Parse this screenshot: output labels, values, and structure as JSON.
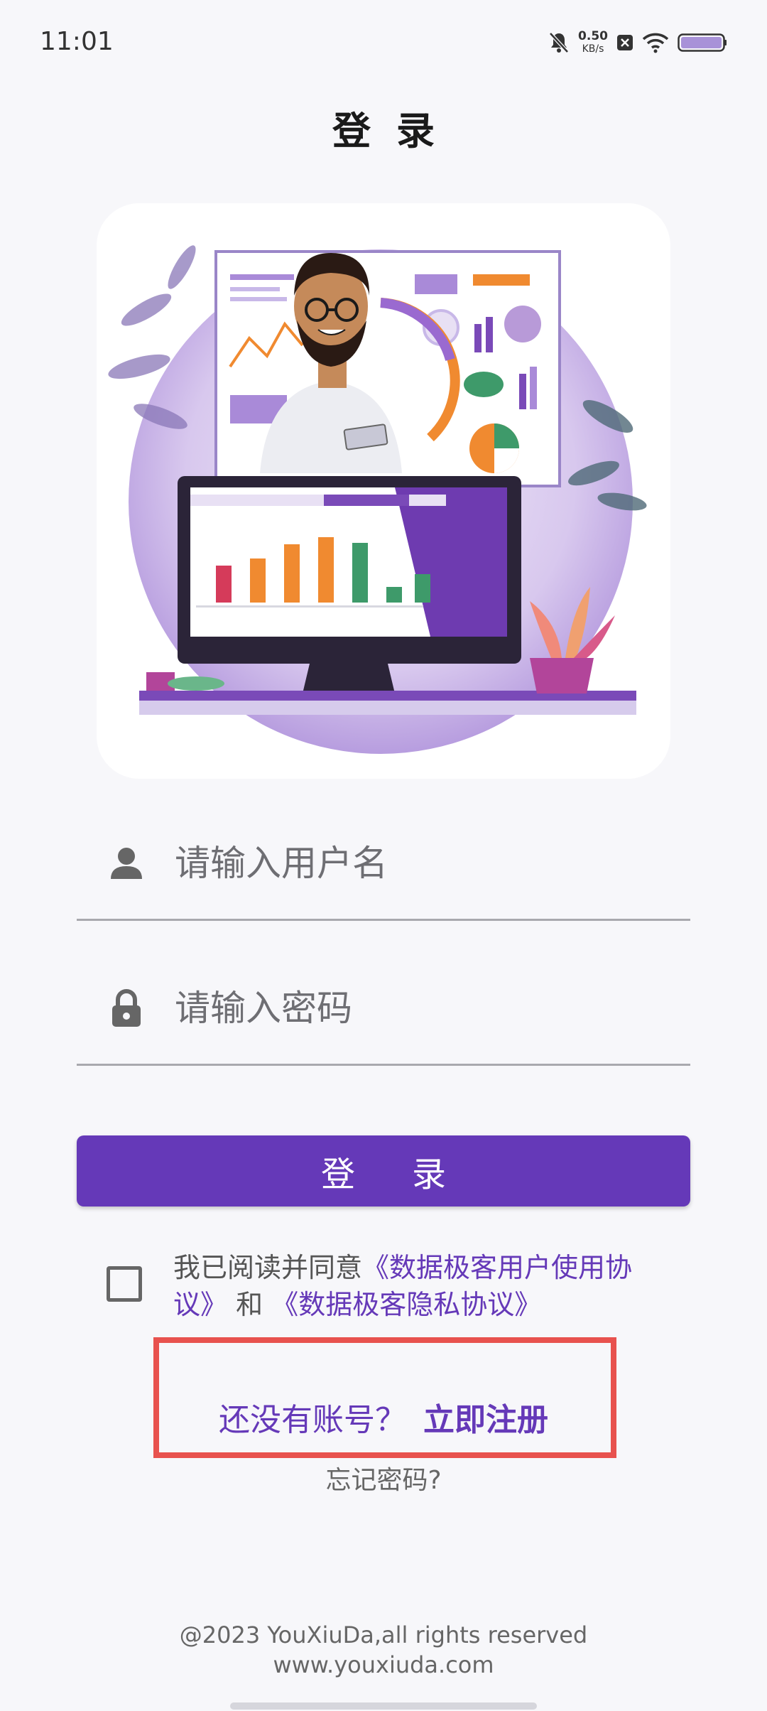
{
  "status_bar": {
    "time": "11:01",
    "net_speed_value": "0.50",
    "net_speed_unit": "KB/s",
    "icons": [
      "mute-icon",
      "close-box-icon",
      "wifi-icon",
      "battery-icon"
    ]
  },
  "page": {
    "title": "登录"
  },
  "form": {
    "username_placeholder": "请输入用户名",
    "password_placeholder": "请输入密码",
    "login_label": "登录"
  },
  "agreement": {
    "prefix": "我已阅读并同意",
    "user_agreement": "《数据极客用户使用协议》",
    "conjunction": "和",
    "privacy_policy": "《数据极客隐私协议》"
  },
  "register": {
    "prompt": "还没有账号？",
    "cta": "立即注册"
  },
  "forgot_password": "忘记密码?",
  "footer": {
    "copyright": "@2023 YouXiuDa,all rights reserved",
    "website": "www.youxiuda.com"
  },
  "colors": {
    "accent": "#6539b8",
    "highlight_border": "#e8524e",
    "background": "#f7f7fa"
  }
}
